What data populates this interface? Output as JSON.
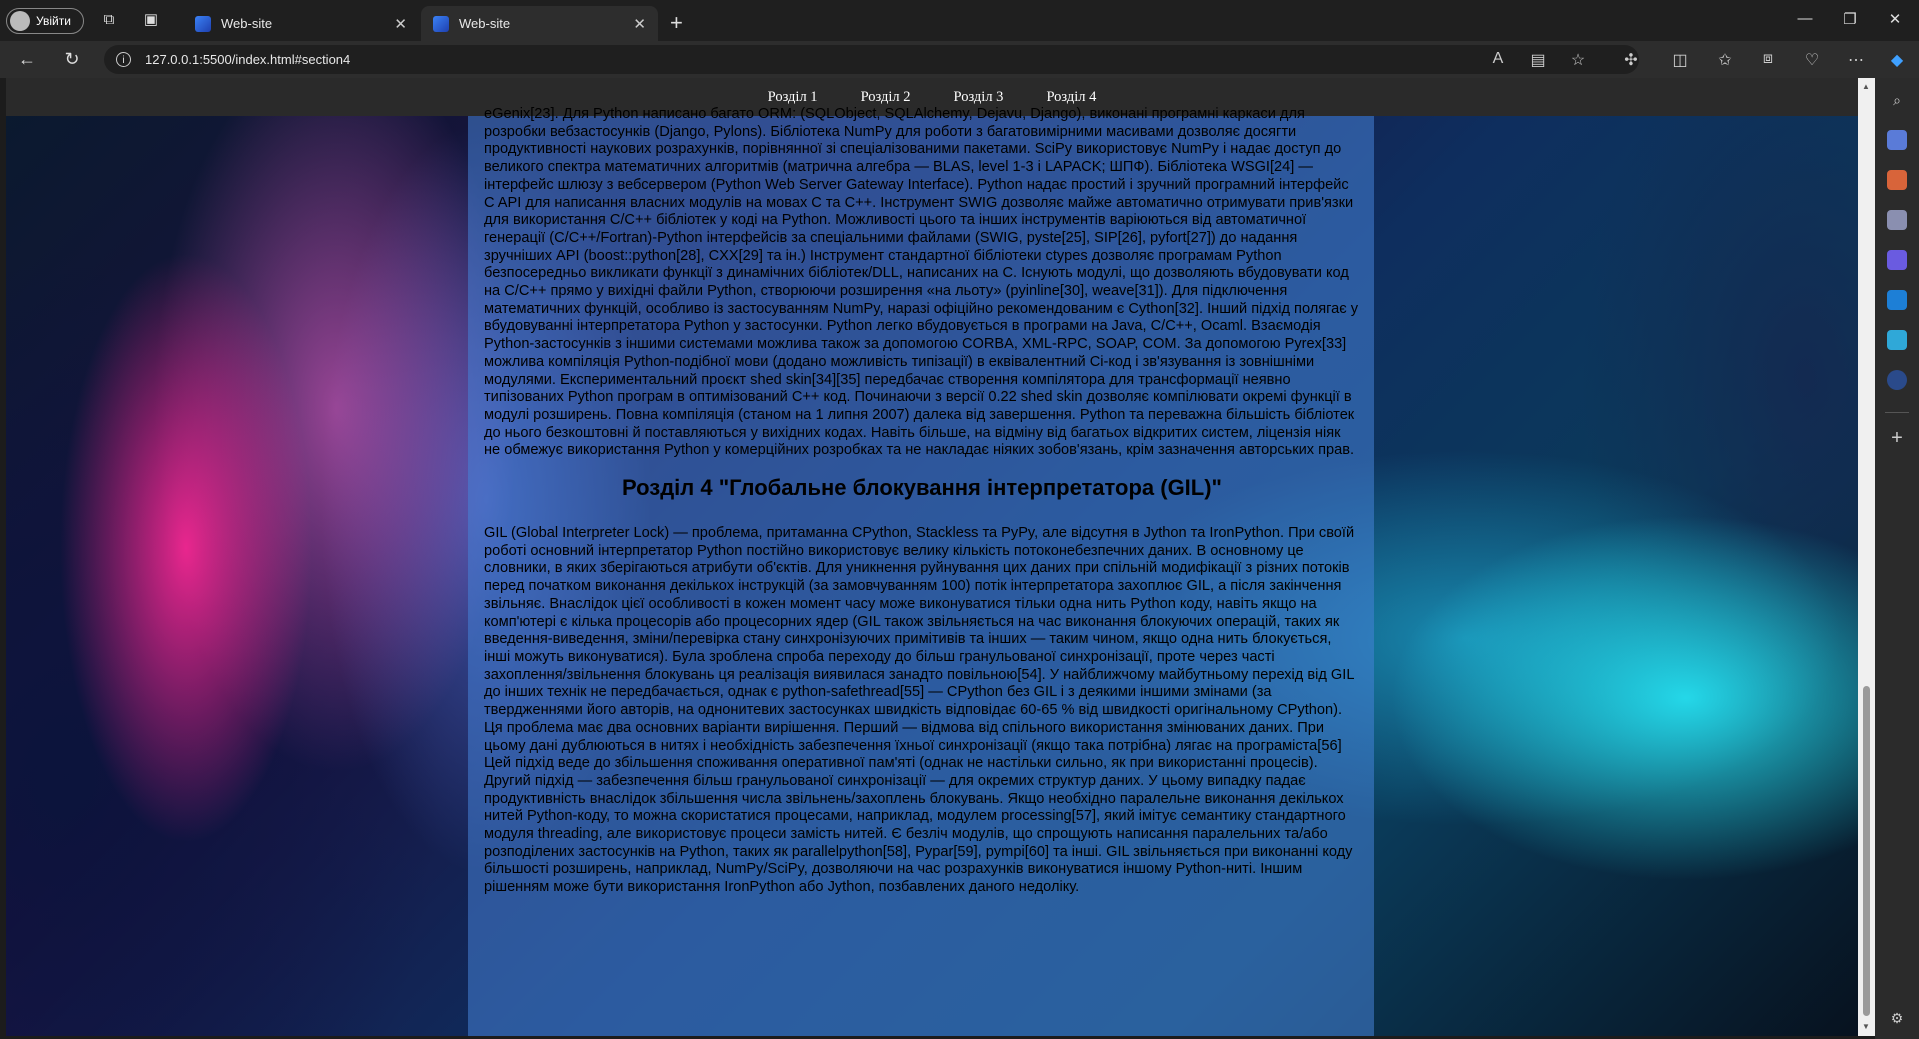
{
  "browser": {
    "profile_label": "Увійти",
    "tabs": [
      {
        "title": "Web-site",
        "active": false
      },
      {
        "title": "Web-site",
        "active": true
      }
    ],
    "url": "127.0.0.1:5500/index.html#section4",
    "icons": {
      "workspaces": "workspaces-icon",
      "tab_actions": "tab-actions-icon",
      "back": "back-arrow-icon",
      "refresh": "refresh-icon",
      "info": "info-icon",
      "read_aloud": "read-aloud-icon",
      "immersive": "immersive-reader-icon",
      "favorite": "star-icon",
      "extensions": "extensions-icon",
      "split": "split-screen-icon",
      "favorites": "favorites-icon",
      "collections": "collections-icon",
      "heart": "health-icon",
      "more": "more-icon",
      "copilot": "copilot-icon"
    }
  },
  "site": {
    "nav": [
      "Розділ 1",
      "Розділ 2",
      "Розділ 3",
      "Розділ 4"
    ],
    "section3_text": "eGenix[23]. Для Python написано багато ORM: (SQLObject, SQLAlchemy, Dejavu, Django), виконані програмні каркаси для розробки вебзастосунків (Django, Pylons). Бібліотека NumPy для роботи з багатовимірними масивами дозволяє досягти продуктивності наукових розрахунків, порівнянної зі спеціалізованими пакетами. SciPy використовує NumPy і надає доступ до великого спектра математичних алгоритмів (матрична алгебра — BLAS, level 1-3 і LAPACK; ШПФ). Бібліотека WSGI[24] — інтерфейс шлюзу з вебсервером (Python Web Server Gateway Interface). Python надає простий і зручний програмний інтерфейс C API для написання власних модулів на мовах C та C++. Інструмент SWIG дозволяє майже автоматично отримувати прив'язки для використання C/C++ бібліотек у коді на Python. Можливості цього та інших інструментів варіюються від автоматичної генерації (C/C++/Fortran)-Python інтерфейсів за спеціальними файлами (SWIG, pyste[25], SIP[26], pyfort[27]) до надання зручніших API (boost::python[28], CXX[29] та ін.) Інструмент стандартної бібліотеки ctypes дозволяє програмам Python безпосередньо викликати функції з динамічних бібліотек/DLL, написаних на C. Існують модулі, що дозволяють вбудовувати код на C/C++ прямо у вихідні файли Python, створюючи розширення «на льоту» (pyinline[30], weave[31]). Для підключення математичних функцій, особливо із застосуванням NumPy, наразі офіційно рекомендованим є Cython[32]. Інший підхід полягає у вбудовуванні інтерпретатора Python у застосунки. Python легко вбудовується в програми на Java, C/C++, Ocaml. Взаємодія Python-застосунків з іншими системами можлива також за допомогою CORBA, XML-RPC, SOAP, COM. За допомогою Pyrex[33] можлива компіляція Python-подібної мови (додано можливість типізації) в еквівалентний Сі-код і зв'язування із зовнішніми модулями. Експериментальний проєкт shed skin[34][35] передбачає створення компілятора для трансформації неявно типізованих Python програм в оптимізований C++ код. Починаючи з версії 0.22 shed skin дозволяє компілювати окремі функції в модулі розширень. Повна компіляція (станом на 1 липня 2007) далека від завершення. Python та переважна більшість бібліотек до нього безкоштовні й поставляються у вихідних кодах. Навіть більше, на відміну від багатьох відкритих систем, ліцензія ніяк не обмежує використання Python у комерційних розробках та не накладає ніяких зобов'язань, крім зазначення авторських прав.",
    "section4_title": "Розділ 4 \"Глобальне блокування інтерпретатора (GIL)\"",
    "section4_text": "GIL (Global Interpreter Lock) — проблема, притаманна CPython, Stackless та PyPy, але відсутня в Jython та IronPython. При своїй роботі основний інтерпретатор Python постійно використовує велику кількість потоконебезпечних даних. В основному це словники, в яких зберігаються атрибути об'єктів. Для уникнення руйнування цих даних при спільній модифікації з різних потоків перед початком виконання декількох інструкцій (за замовчуванням 100) потік інтерпретатора захоплює GIL, а після закінчення звільняє. Внаслідок цієї особливості в кожен момент часу може виконуватися тільки одна нить Python коду, навіть якщо на комп'ютері є кілька процесорів або процесорних ядер (GIL також звільняється на час виконання блокуючих операцій, таких як введення-виведення, зміни/перевірка стану синхронізуючих примітивів та інших — таким чином, якщо одна нить блокується, інші можуть виконуватися). Була зроблена спроба переходу до більш гранульованої синхронізації, проте через часті захоплення/звільнення блокувань ця реалізація виявилася занадто повільною[54]. У найближчому майбутньому перехід від GIL до інших технік не передбачається, однак є python-safethread[55] — CPython без GIL і з деякими іншими змінами (за твердженнями його авторів, на однонитевих застосунках швидкість відповідає 60-65 % від швидкості оригінальному CPython). Ця проблема має два основних варіанти вирішення. Перший — відмова від спільного використання змінюваних даних. При цьому дані дублюються в нитях і необхідність забезпечення їхньої синхронізації (якщо така потрібна) лягає на програміста[56] Цей підхід веде до збільшення споживання оперативної пам'яті (однак не настільки сильно, як при використанні процесів). Другий підхід — забезпечення більш гранульованої синхронізації — для окремих структур даних. У цьому випадку падає продуктивність внаслідок збільшення числа звільнень/захоплень блокувань. Якщо необхідно паралельне виконання декількох нитей Python-коду, то можна скористатися процесами, наприклад, модулем processing[57], який імітує семантику стандартного модуля threading, але використовує процеси замість нитей. Є безліч модулів, що спрощують написання паралельних та/або розподілених застосунків на Python, таких як parallelpython[58], Pypar[59], pympi[60] та інші. GIL звільняється при виконанні коду більшості розширень, наприклад, NumPy/SciPy, дозволяючи на час розрахунків виконуватися іншому Python-ниті. Іншим рішенням може бути використання IronPython або Jython, позбавлених даного недоліку."
  }
}
